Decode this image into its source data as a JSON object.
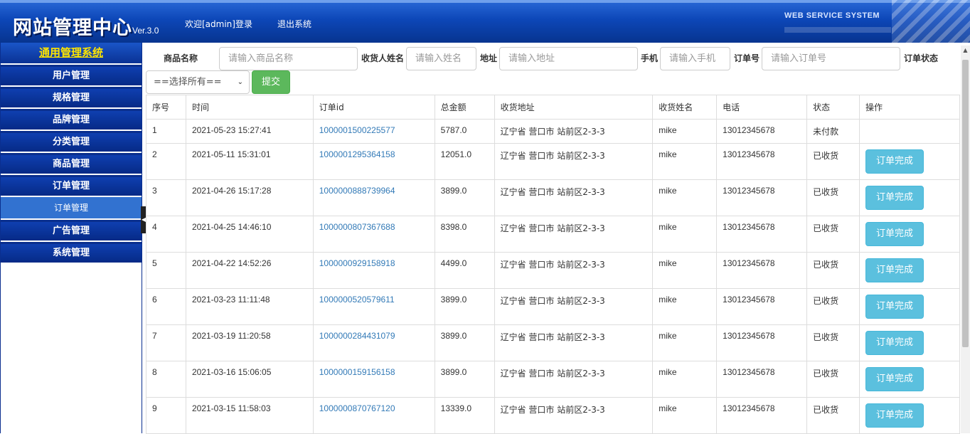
{
  "header": {
    "logo": "网站管理中心",
    "version": "Ver.3.0",
    "welcome_link": "欢迎[admin]登录",
    "logout_link": "退出系统",
    "tagline": "WEB SERVICE SYSTEM"
  },
  "sidebar": {
    "title": "通用管理系统",
    "items": [
      {
        "label": "用户管理"
      },
      {
        "label": "规格管理"
      },
      {
        "label": "品牌管理"
      },
      {
        "label": "分类管理"
      },
      {
        "label": "商品管理"
      },
      {
        "label": "订单管理"
      }
    ],
    "active_sub": "订单管理",
    "items_after": [
      {
        "label": "广告管理"
      },
      {
        "label": "系统管理"
      }
    ]
  },
  "filters": {
    "product_name_label": "商品名称",
    "product_name_placeholder": "请输入商品名称",
    "receiver_label": "收货人姓名",
    "receiver_placeholder": "请输入姓名",
    "address_label": "地址",
    "address_placeholder": "请输入地址",
    "phone_label": "手机",
    "phone_placeholder": "请输入手机",
    "order_no_label": "订单号",
    "order_no_placeholder": "请输入订单号",
    "status_label": "订单状态",
    "status_selected": "==选择所有==",
    "submit_label": "提交"
  },
  "table": {
    "headers": [
      "序号",
      "时间",
      "订单id",
      "总金额",
      "收货地址",
      "收货姓名",
      "电话",
      "状态",
      "操作"
    ],
    "action_label": "订单完成",
    "rows": [
      {
        "no": "1",
        "time": "2021-05-23 15:27:41",
        "order_id": "1000001500225577",
        "amount": "5787.0",
        "address": "辽宁省 营口市 站前区2-3-3",
        "name": "mike",
        "phone": "13012345678",
        "status": "未付款",
        "action": ""
      },
      {
        "no": "2",
        "time": "2021-05-11 15:31:01",
        "order_id": "1000001295364158",
        "amount": "12051.0",
        "address": "辽宁省 营口市 站前区2-3-3",
        "name": "mike",
        "phone": "13012345678",
        "status": "已收货",
        "action": "订单完成"
      },
      {
        "no": "3",
        "time": "2021-04-26 15:17:28",
        "order_id": "1000000888739964",
        "amount": "3899.0",
        "address": "辽宁省 营口市 站前区2-3-3",
        "name": "mike",
        "phone": "13012345678",
        "status": "已收货",
        "action": "订单完成"
      },
      {
        "no": "4",
        "time": "2021-04-25 14:46:10",
        "order_id": "1000000807367688",
        "amount": "8398.0",
        "address": "辽宁省 营口市 站前区2-3-3",
        "name": "mike",
        "phone": "13012345678",
        "status": "已收货",
        "action": "订单完成"
      },
      {
        "no": "5",
        "time": "2021-04-22 14:52:26",
        "order_id": "1000000929158918",
        "amount": "4499.0",
        "address": "辽宁省 营口市 站前区2-3-3",
        "name": "mike",
        "phone": "13012345678",
        "status": "已收货",
        "action": "订单完成"
      },
      {
        "no": "6",
        "time": "2021-03-23 11:11:48",
        "order_id": "1000000520579611",
        "amount": "3899.0",
        "address": "辽宁省 营口市 站前区2-3-3",
        "name": "mike",
        "phone": "13012345678",
        "status": "已收货",
        "action": "订单完成"
      },
      {
        "no": "7",
        "time": "2021-03-19 11:20:58",
        "order_id": "1000000284431079",
        "amount": "3899.0",
        "address": "辽宁省 营口市 站前区2-3-3",
        "name": "mike",
        "phone": "13012345678",
        "status": "已收货",
        "action": "订单完成"
      },
      {
        "no": "8",
        "time": "2021-03-16 15:06:05",
        "order_id": "1000000159156158",
        "amount": "3899.0",
        "address": "辽宁省 营口市 站前区2-3-3",
        "name": "mike",
        "phone": "13012345678",
        "status": "已收货",
        "action": "订单完成"
      },
      {
        "no": "9",
        "time": "2021-03-15 11:58:03",
        "order_id": "1000000870767120",
        "amount": "13339.0",
        "address": "辽宁省 营口市 站前区2-3-3",
        "name": "mike",
        "phone": "13012345678",
        "status": "已收货",
        "action": "订单完成"
      }
    ]
  }
}
